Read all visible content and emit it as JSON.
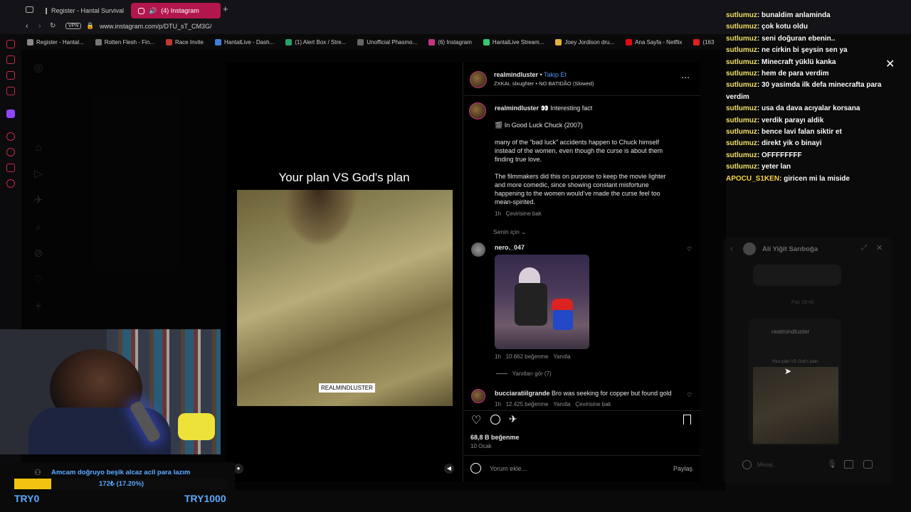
{
  "browser": {
    "tabs": [
      {
        "title": "Register - Hantal Survival",
        "active": false
      },
      {
        "title": "(4) Instagram",
        "active": true
      }
    ],
    "url": "www.instagram.com/p/DTU_sT_CM3G/",
    "vpn_label": "VPN",
    "bookmarks": [
      {
        "label": "Register - Hantal...",
        "color": "#888"
      },
      {
        "label": "Rotten Flesh - Fin...",
        "color": "#777"
      },
      {
        "label": "Race Invite",
        "color": "#c0392b"
      },
      {
        "label": "HantalLive - Dash...",
        "color": "#3f7fd8"
      },
      {
        "label": "(1) Alert Box / Stre...",
        "color": "#26a269"
      },
      {
        "label": "Unofficial Phasmo...",
        "color": "#666"
      },
      {
        "label": "(6) Instagram",
        "color": "#c13584"
      },
      {
        "label": "HantalLive Stream...",
        "color": "#2ecc71"
      },
      {
        "label": "Joey Jordison dru...",
        "color": "#e1b23a"
      },
      {
        "label": "Ana Sayfa - Netflix",
        "color": "#e50914"
      },
      {
        "label": "(163",
        "color": "#e02020"
      }
    ]
  },
  "post": {
    "author": "realmindluster",
    "follow_label": "Takip Et",
    "audio": "ZXKAI, slxughter • NO BATIDÃO (Slowed)",
    "video_caption": "Your plan VS God's plan",
    "watermark": "REALMINDLUSTER",
    "caption_user": "realmindluster",
    "caption_head": "👀 Interesting fact",
    "caption_movie": "🎬 In Good Luck Chuck (2007)",
    "caption_p1": "many of the “bad luck” accidents happen to Chuck himself instead of the women, even though the curse is about them finding true love.",
    "caption_p2": "The filmmakers did this on purpose to keep the movie lighter and more comedic, since showing constant misfortune happening to the women would’ve made the curse feel too mean-spirited.",
    "caption_time": "1h",
    "see_translation": "Çevirisine bak",
    "for_you": "Senin için",
    "comments": [
      {
        "user": "nero._047",
        "time": "1h",
        "likes": "10.662 beğenme",
        "reply": "Yanıtla",
        "view_replies": "Yanıtları gör (7)"
      },
      {
        "user": "bucciaratiilgrande",
        "text": "Bro was seeking for copper but found gold",
        "time": "1h",
        "likes": "12.425 beğenme",
        "reply": "Yanıtla",
        "translate": "Çevirisine bak"
      }
    ],
    "like_count": "68,8 B beğenme",
    "date": "10 Ocak",
    "comment_placeholder": "Yorum ekle...",
    "share_label": "Paylaş",
    "take_label": "Takip Et"
  },
  "chat": [
    {
      "user": "sutlumuz",
      "msg": "bunaldim anlaminda"
    },
    {
      "user": "sutlumuz",
      "msg": "çok kotu oldu"
    },
    {
      "user": "sutlumuz",
      "msg": "seni doğuran ebenin.."
    },
    {
      "user": "sutlumuz",
      "msg": "ne cirkin bi şeysin sen ya"
    },
    {
      "user": "sutlumuz",
      "msg": "Minecraft yüklü kanka"
    },
    {
      "user": "sutlumuz",
      "msg": "hem de para verdim"
    },
    {
      "user": "sutlumuz",
      "msg": "30 yasimda ilk defa minecrafta para"
    },
    {
      "user": "",
      "msg": "verdim"
    },
    {
      "user": "sutlumuz",
      "msg": "usa da dava acıyalar korsana"
    },
    {
      "user": "sutlumuz",
      "msg": "verdik parayı aldik"
    },
    {
      "user": "sutlumuz",
      "msg": "bence lavi falan siktir et"
    },
    {
      "user": "sutlumuz",
      "msg": "direkt yik o binayi"
    },
    {
      "user": "sutlumuz",
      "msg": "OFFFFFFFF"
    },
    {
      "user": "sutlumuz",
      "msg": "yeter lan"
    },
    {
      "user": "APOCU_S1KEN",
      "msg": "giricen mi la miside"
    }
  ],
  "dm": {
    "name": "Ali Yiğit Sarıboğa",
    "time": "Paz 19:40",
    "shared_author": "realmindluster",
    "shared_caption": "Your plan VS God's plan",
    "input_placeholder": "Mesaj..."
  },
  "donation": {
    "message": "Amcam doğruyo beşik alcaz acil para lazım",
    "progress_text": "172₺ (17.20%)",
    "progress": 0.172,
    "min_label": "TRY0",
    "max_label": "TRY1000"
  },
  "colors": {
    "accent": "#b3164d",
    "follow": "#4a90e2",
    "chat_name": "#f5e26a",
    "donation_bar": "#f1c40f",
    "donation_text": "#5aa9ff"
  }
}
